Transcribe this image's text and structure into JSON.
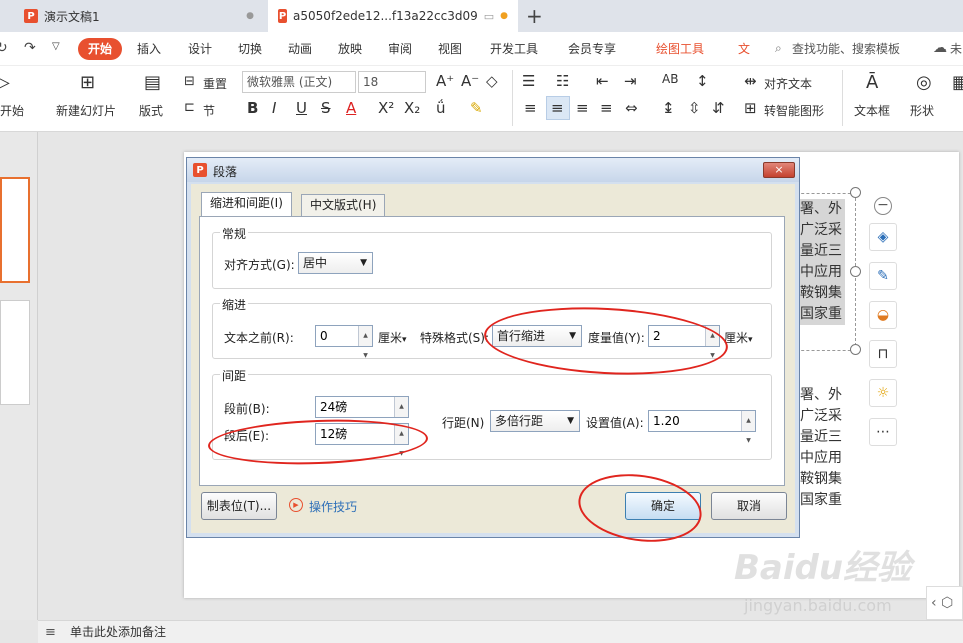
{
  "tabs": [
    {
      "title": "演示文稿1",
      "closable": true
    },
    {
      "title": "a5050f2ede12...f13a22cc3d09",
      "modified": true
    }
  ],
  "menu": {
    "home": "开始",
    "items": [
      "插入",
      "设计",
      "切换",
      "动画",
      "放映",
      "审阅",
      "视图",
      "开发工具",
      "会员专享"
    ],
    "drawing_tools": "绘图工具",
    "search_placeholder": "查找功能、搜索模板",
    "cut_partial": "文",
    "right_partial": "未"
  },
  "ribbon": {
    "play_from": "开始",
    "new_slide": "新建幻灯片",
    "layout": "版式",
    "section": "节",
    "reset": "重置",
    "font_name": "微软雅黑 (正文)",
    "font_size": "18",
    "align_text": "对齐文本",
    "convert_smartart": "转智能图形",
    "text_box": "文本框",
    "shape": "形状"
  },
  "slide_text": {
    "top_block": [
      "署、外",
      "广泛采",
      "量近三",
      "中应用",
      "鞍钢集",
      "国家重"
    ],
    "bottom_block": [
      "署、外",
      "广泛采",
      "量近三",
      "中应用",
      "鞍钢集",
      "国家重"
    ]
  },
  "notes_placeholder": "单击此处添加备注",
  "watermark": {
    "logo": "Baidu经验",
    "url": "jingyan.baidu.com"
  },
  "dialog": {
    "title": "段落",
    "close": "×",
    "tabs": [
      "缩进和间距(I)",
      "中文版式(H)"
    ],
    "general": {
      "title": "常规",
      "alignment_label": "对齐方式(G):",
      "alignment_value": "居中"
    },
    "indent": {
      "title": "缩进",
      "before_text_label": "文本之前(R):",
      "before_text_value": "0",
      "unit": "厘米",
      "special_label": "特殊格式(S):",
      "special_value": "首行缩进",
      "measure_label": "度量值(Y):",
      "measure_value": "2",
      "measure_unit": "厘米"
    },
    "spacing": {
      "title": "间距",
      "before_label": "段前(B):",
      "before_value": "24磅",
      "after_label": "段后(E):",
      "after_value": "12磅",
      "line_label": "行距(N)",
      "line_value": "多倍行距",
      "set_value_label": "设置值(A):",
      "set_value": "1.20"
    },
    "tab_stops": "制表位(T)...",
    "tips": "操作技巧",
    "ok": "确定",
    "cancel": "取消"
  },
  "accent": {
    "wps_orange": "#e8502f",
    "annotation_red": "#e0251e",
    "dialog_blue": "#d4e0ef"
  }
}
